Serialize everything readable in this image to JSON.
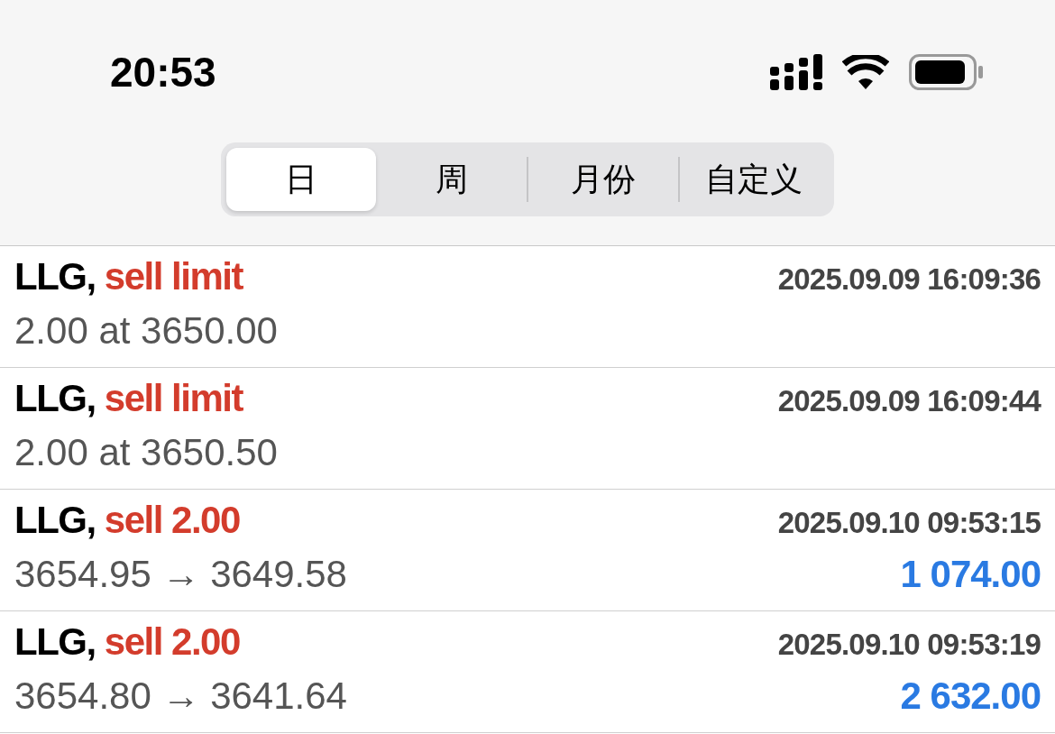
{
  "status_bar": {
    "time": "20:53"
  },
  "period_tabs": [
    {
      "label": "日",
      "selected": true
    },
    {
      "label": "周",
      "selected": false
    },
    {
      "label": "月份",
      "selected": false
    },
    {
      "label": "自定义",
      "selected": false
    }
  ],
  "orders": [
    {
      "symbol": "LLG,",
      "action": "sell limit",
      "time": "2025.09.09 16:09:36",
      "detail": "2.00 at 3650.00"
    },
    {
      "symbol": "LLG,",
      "action": "sell limit",
      "time": "2025.09.09 16:09:44",
      "detail": "2.00 at 3650.50"
    },
    {
      "symbol": "LLG,",
      "action": "sell 2.00",
      "time": "2025.09.10 09:53:15",
      "detail": "3654.95 → 3649.58",
      "profit": "1 074.00"
    },
    {
      "symbol": "LLG,",
      "action": "sell 2.00",
      "time": "2025.09.10 09:53:19",
      "detail": "3654.80 → 3641.64",
      "profit": "2 632.00"
    }
  ]
}
